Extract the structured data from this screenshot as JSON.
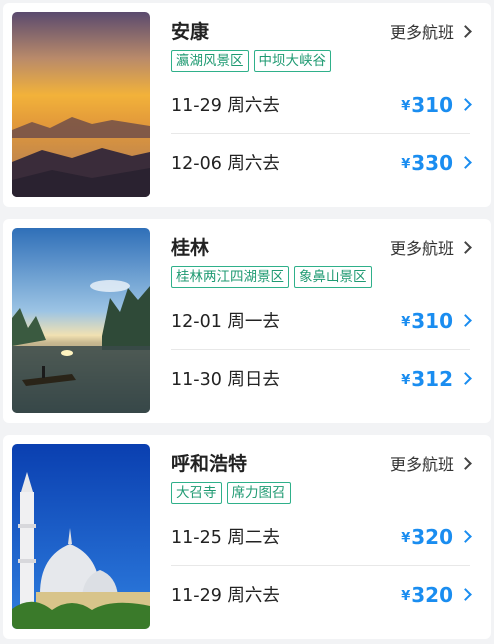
{
  "currency_symbol": "¥",
  "more_label": "更多航班",
  "destinations": [
    {
      "city": "安康",
      "tags": [
        "瀛湖风景区",
        "中坝大峡谷"
      ],
      "flights": [
        {
          "date": "11-29 周六去",
          "price": "310"
        },
        {
          "date": "12-06 周六去",
          "price": "330"
        }
      ]
    },
    {
      "city": "桂林",
      "tags": [
        "桂林两江四湖景区",
        "象鼻山景区"
      ],
      "flights": [
        {
          "date": "12-01 周一去",
          "price": "310"
        },
        {
          "date": "11-30 周日去",
          "price": "312"
        }
      ]
    },
    {
      "city": "呼和浩特",
      "tags": [
        "大召寺",
        "席力图召"
      ],
      "flights": [
        {
          "date": "11-25 周二去",
          "price": "320"
        },
        {
          "date": "11-29 周六去",
          "price": "320"
        }
      ]
    }
  ],
  "colors": {
    "price": "#1a8df0",
    "tag": "#1f9a72",
    "background": "#f2f3f5"
  }
}
